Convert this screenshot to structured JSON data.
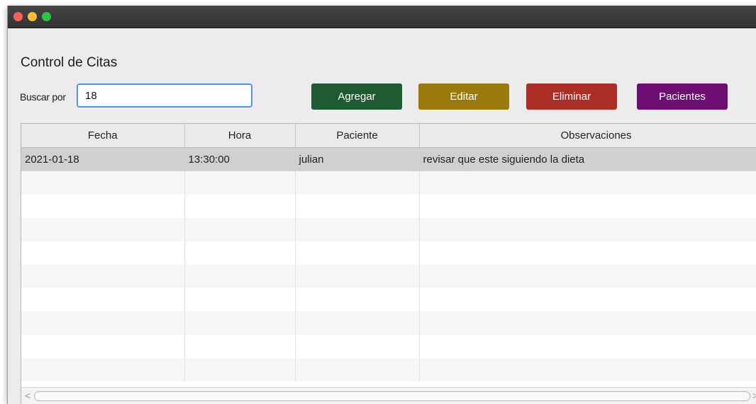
{
  "window": {
    "traffic_lights": [
      "close",
      "minimize",
      "zoom"
    ]
  },
  "header": {
    "title": "Control de Citas"
  },
  "search": {
    "label": "Buscar por",
    "value": "18"
  },
  "toolbar": {
    "add_label": "Agregar",
    "edit_label": "Editar",
    "delete_label": "Eliminar",
    "patients_label": "Pacientes",
    "colors": {
      "add": "#1e5b33",
      "edit": "#9b7a0b",
      "delete": "#ab2f27",
      "patients": "#6e0e73"
    }
  },
  "table": {
    "columns": [
      "Fecha",
      "Hora",
      "Paciente",
      "Observaciones"
    ],
    "rows": [
      [
        "2021-01-18",
        "13:30:00",
        "julian",
        "revisar que este siguiendo la dieta"
      ]
    ]
  },
  "scrollbar": {
    "left_arrow": "<",
    "right_arrow": ">"
  }
}
